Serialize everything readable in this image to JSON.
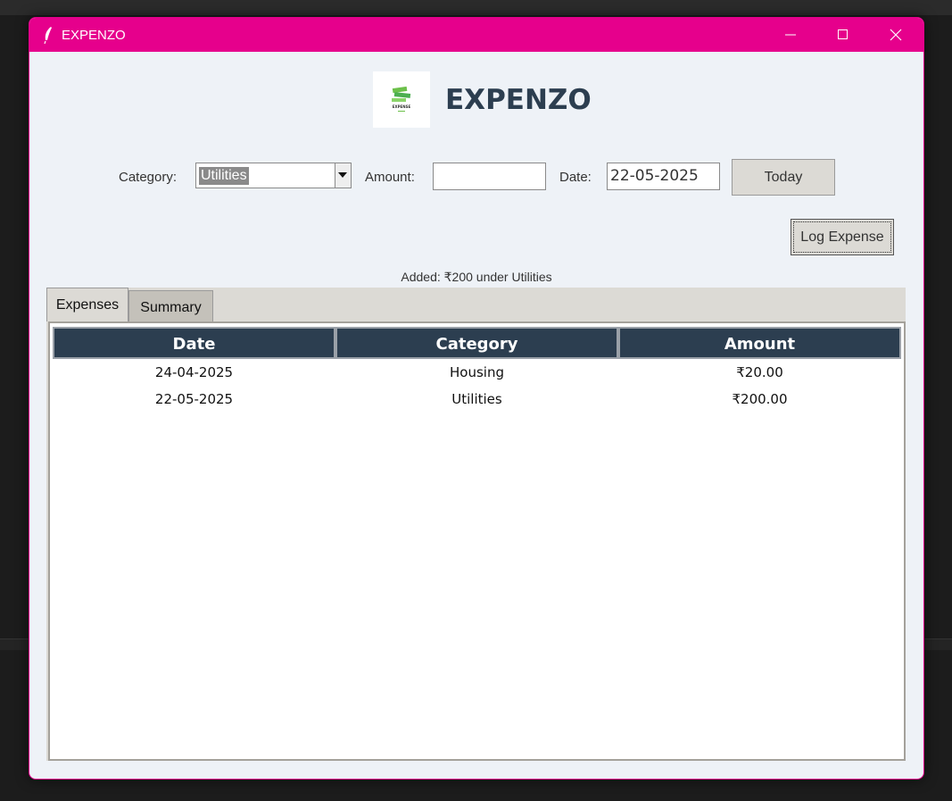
{
  "window": {
    "title": "EXPENZO"
  },
  "header": {
    "app_name": "EXPENZO",
    "logo_text": "EXPENSE"
  },
  "form": {
    "category_label": "Category:",
    "category_value": "Utilities",
    "amount_label": "Amount:",
    "amount_value": "",
    "date_label": "Date:",
    "date_value": "22-05-2025",
    "today_button": "Today",
    "log_button": "Log Expense"
  },
  "status": "Added: ₹200 under Utilities",
  "tabs": [
    {
      "label": "Expenses",
      "active": true
    },
    {
      "label": "Summary",
      "active": false
    }
  ],
  "table": {
    "columns": [
      "Date",
      "Category",
      "Amount"
    ],
    "rows": [
      [
        "24-04-2025",
        "Housing",
        "₹20.00"
      ],
      [
        "22-05-2025",
        "Utilities",
        "₹200.00"
      ]
    ]
  },
  "colors": {
    "titlebar": "#e6008c",
    "header_bg": "#2c3e50",
    "window_bg": "#eef2f7"
  }
}
